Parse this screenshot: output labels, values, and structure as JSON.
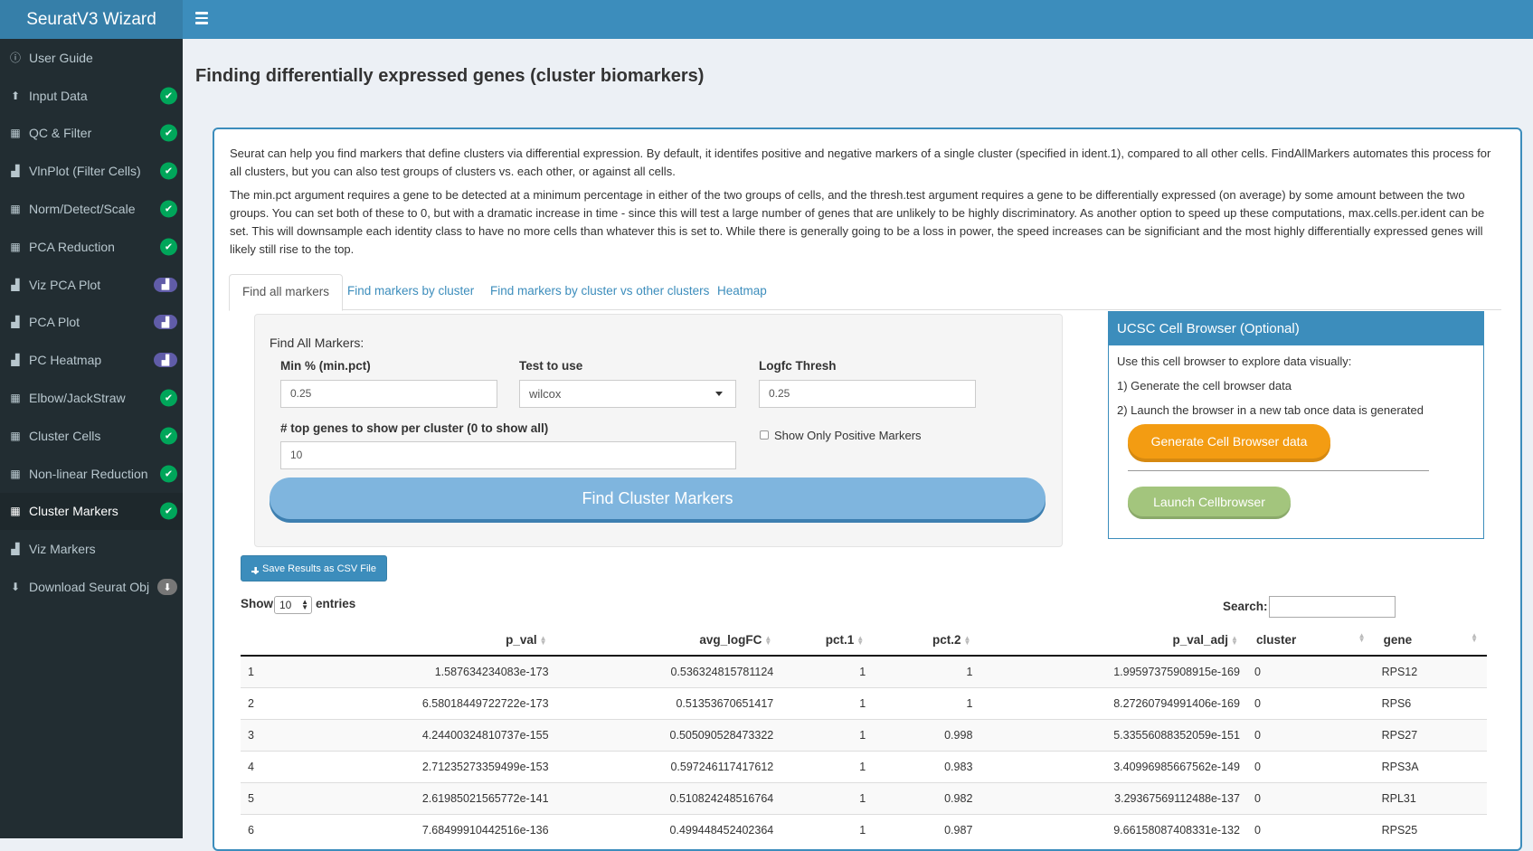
{
  "app": {
    "title": "SeuratV3 Wizard"
  },
  "sidebar": {
    "items": [
      {
        "label": "User Guide",
        "icon": "info-icon",
        "badge": "none"
      },
      {
        "label": "Input Data",
        "icon": "upload-icon",
        "badge": "check"
      },
      {
        "label": "QC & Filter",
        "icon": "grid-icon",
        "badge": "check"
      },
      {
        "label": "VlnPlot (Filter Cells)",
        "icon": "bar-chart-icon",
        "badge": "check"
      },
      {
        "label": "Norm/Detect/Scale",
        "icon": "grid-icon",
        "badge": "check"
      },
      {
        "label": "PCA Reduction",
        "icon": "grid-icon",
        "badge": "check"
      },
      {
        "label": "Viz PCA Plot",
        "icon": "bar-chart-icon",
        "badge": "chart"
      },
      {
        "label": "PCA Plot",
        "icon": "bar-chart-icon",
        "badge": "chart"
      },
      {
        "label": "PC Heatmap",
        "icon": "bar-chart-icon",
        "badge": "chart"
      },
      {
        "label": "Elbow/JackStraw",
        "icon": "grid-icon",
        "badge": "check"
      },
      {
        "label": "Cluster Cells",
        "icon": "grid-icon",
        "badge": "check"
      },
      {
        "label": "Non-linear Reduction",
        "icon": "grid-icon",
        "badge": "check"
      },
      {
        "label": "Cluster Markers",
        "icon": "grid-icon",
        "badge": "check",
        "active": true
      },
      {
        "label": "Viz Markers",
        "icon": "bar-chart-icon",
        "badge": "none"
      },
      {
        "label": "Download Seurat Obj",
        "icon": "download-icon",
        "badge": "download"
      }
    ]
  },
  "page": {
    "title": "Finding differentially expressed genes (cluster biomarkers)",
    "para1": "Seurat can help you find markers that define clusters via differential expression. By default, it identifes positive and negative markers of a single cluster (specified in ident.1), compared to all other cells. FindAllMarkers automates this process for all clusters, but you can also test groups of clusters vs. each other, or against all cells.",
    "para2": "The min.pct argument requires a gene to be detected at a minimum percentage in either of the two groups of cells, and the thresh.test argument requires a gene to be differentially expressed (on average) by some amount between the two groups. You can set both of these to 0, but with a dramatic increase in time - since this will test a large number of genes that are unlikely to be highly discriminatory. As another option to speed up these computations, max.cells.per.ident can be set. This will downsample each identity class to have no more cells than whatever this is set to. While there is generally going to be a loss in power, the speed increases can be significiant and the most highly differentially expressed genes will likely still rise to the top."
  },
  "tabs": [
    "Find all markers",
    "Find markers by cluster",
    "Find markers by cluster vs other clusters",
    "Heatmap"
  ],
  "form": {
    "heading": "Find All Markers:",
    "min_pct_label": "Min % (min.pct)",
    "min_pct_value": "0.25",
    "test_label": "Test to use",
    "test_value": "wilcox",
    "logfc_label": "Logfc Thresh",
    "logfc_value": "0.25",
    "top_genes_label": "# top genes to show per cluster (0 to show all)",
    "top_genes_value": "10",
    "positive_label": "Show Only Positive Markers",
    "find_button": "Find Cluster Markers"
  },
  "ucsc": {
    "title": "UCSC Cell Browser (Optional)",
    "line1": "Use this cell browser to explore data visually:",
    "line2": "1) Generate the cell browser data",
    "line3": "2) Launch the browser in a new tab once data is generated",
    "generate_button": "Generate Cell Browser data",
    "launch_button": "Launch Cellbrowser",
    "generate_color": "#f39c12",
    "launch_color": "#a3c57d"
  },
  "results": {
    "csv_button": "Save Results as CSV File",
    "show_label": "Show",
    "entries_value": "10",
    "entries_label": "entries",
    "search_label": "Search:",
    "columns": [
      "",
      "p_val",
      "avg_logFC",
      "pct.1",
      "pct.2",
      "p_val_adj",
      "cluster",
      "gene"
    ],
    "rows": [
      [
        "1",
        "1.587634234083e-173",
        "0.536324815781124",
        "1",
        "1",
        "1.99597375908915e-169",
        "0",
        "RPS12"
      ],
      [
        "2",
        "6.58018449722722e-173",
        "0.51353670651417",
        "1",
        "1",
        "8.27260794991406e-169",
        "0",
        "RPS6"
      ],
      [
        "3",
        "4.24400324810737e-155",
        "0.505090528473322",
        "1",
        "0.998",
        "5.33556088352059e-151",
        "0",
        "RPS27"
      ],
      [
        "4",
        "2.71235273359499e-153",
        "0.597246117417612",
        "1",
        "0.983",
        "3.40996985667562e-149",
        "0",
        "RPS3A"
      ],
      [
        "5",
        "2.61985021565772e-141",
        "0.510824248516764",
        "1",
        "0.982",
        "3.29367569112488e-137",
        "0",
        "RPL31"
      ],
      [
        "6",
        "7.68499910442516e-136",
        "0.499448452402364",
        "1",
        "0.987",
        "9.66158087408331e-132",
        "0",
        "RPS25"
      ]
    ]
  }
}
